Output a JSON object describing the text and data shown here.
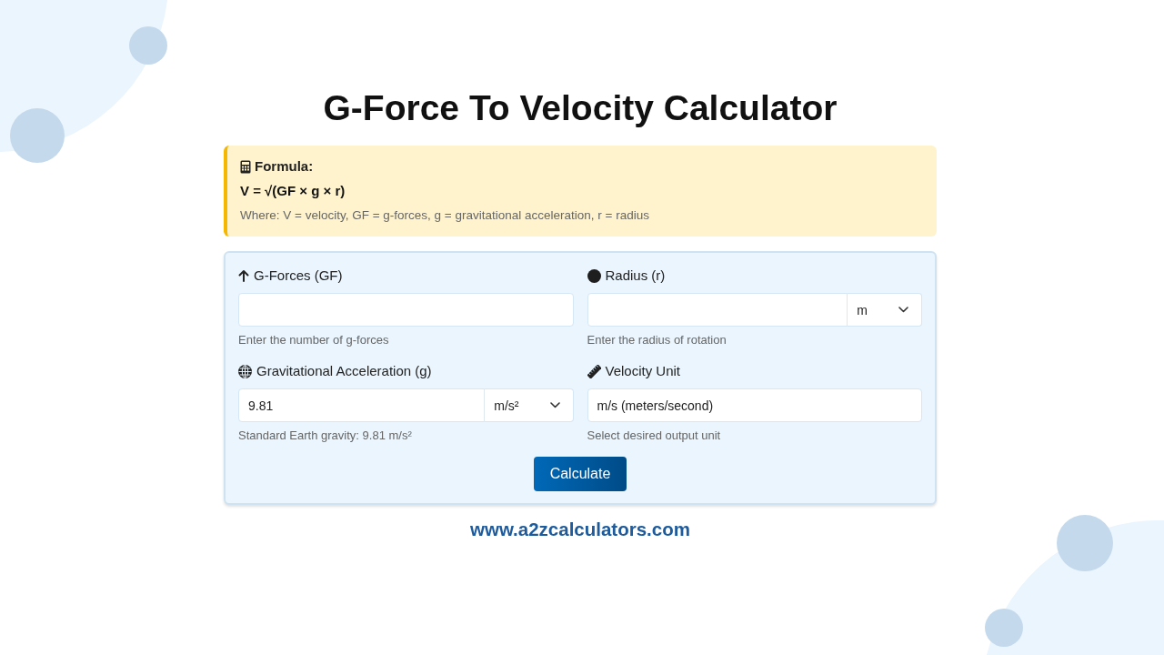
{
  "title": "G-Force To Velocity Calculator",
  "formula": {
    "heading": "Formula:",
    "expression": "V = √(GF × g × r)",
    "note": "Where: V = velocity, GF = g-forces, g = gravitational acceleration, r = radius"
  },
  "fields": [
    {
      "kind": "input",
      "label": "G-Forces (GF)",
      "help": "Enter the number of g-forces"
    },
    {
      "kind": "input-unit",
      "label": "Radius (r)",
      "unit": "m",
      "help": "Enter the radius of rotation"
    },
    {
      "kind": "input-unit",
      "label": "Gravitational Acceleration (g)",
      "value": "9.81",
      "unit": "m/s²",
      "help": "Standard Earth gravity: 9.81 m/s²"
    },
    {
      "kind": "select",
      "label": "Velocity Unit",
      "value": "m/s (meters/second)",
      "help": "Select desired output unit"
    }
  ],
  "button": "Calculate",
  "footer": "www.a2zcalculators.com"
}
